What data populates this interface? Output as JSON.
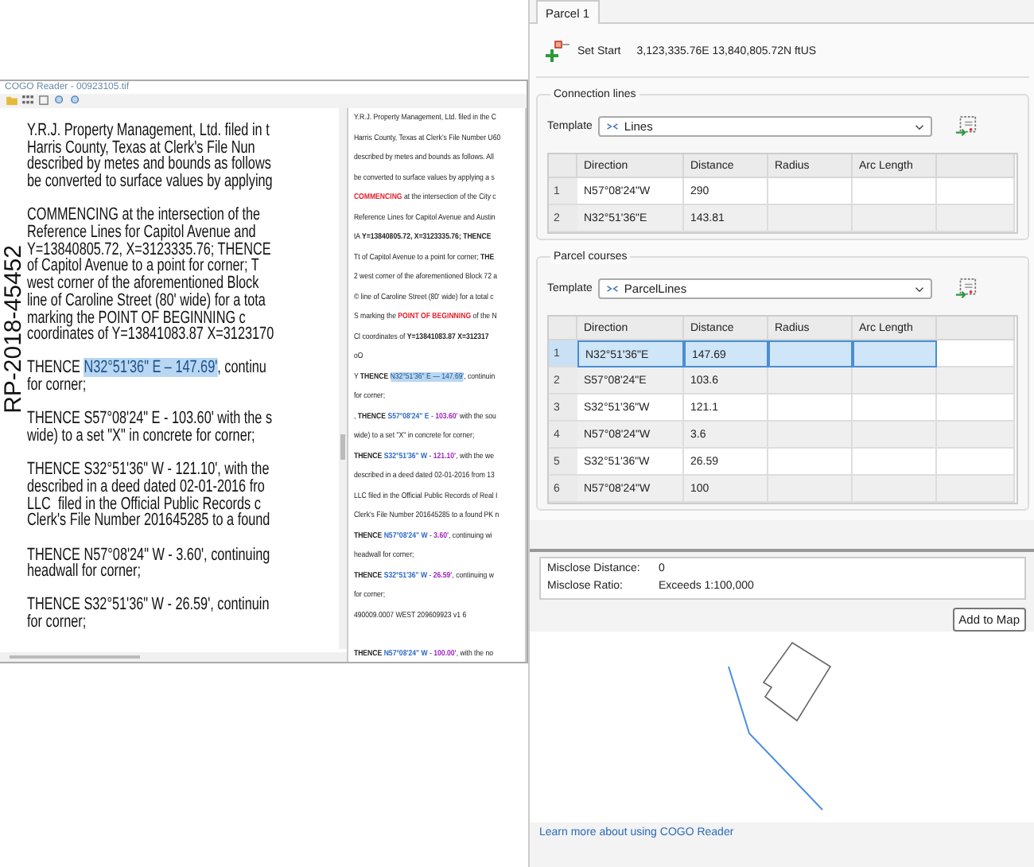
{
  "reader_window": {
    "title": "COGO Reader - 00923105.tif",
    "document": {
      "stamp": "RP-2018-45452",
      "paragraphs": [
        [
          "Y.R.J. Property Management, Ltd. filed in t",
          "Harris County, Texas at Clerk's File Nun",
          "described by metes and bounds as follows",
          "be converted to surface values by applying"
        ],
        [
          "COMMENCING at the intersection of the",
          "Reference Lines for Capitol Avenue and",
          "Y=13840805.72, X=3123335.76; THENCE",
          "of Capitol Avenue to a point for corner; T",
          "west corner of the aforementioned Block",
          "line of Caroline Street (80' wide) for a tota",
          "marking the POINT OF BEGINNING c",
          "coordinates of Y=13841083.87 X=3123170"
        ],
        [
          [
            {
              "kind": "plain",
              "text": "THENCE "
            },
            {
              "kind": "highlight",
              "text": "N32°51'36\" E – 147.69'"
            },
            {
              "kind": "plain",
              "text": ", continu"
            }
          ],
          "for corner;"
        ],
        [
          "THENCE S57°08'24\" E - 103.60' with the s",
          "wide) to a set \"X\" in concrete for corner;"
        ],
        [
          "THENCE S32°51'36\" W - 121.10', with the",
          "described in a deed dated 02-01-2016 fro",
          "LLC  filed in the Official Public Records c",
          "Clerk's File Number 201645285 to a found"
        ],
        [
          "THENCE N57°08'24\" W - 3.60', continuing",
          "headwall for corner;"
        ],
        [
          "THENCE S32°51'36\" W - 26.59', continuin",
          "for corner;"
        ]
      ]
    },
    "ocr_text": {
      "lines": [
        "Y.R.J. Property Management, Ltd. filed in the C",
        "Harris County, Texas at Clerk's File Number U60",
        "described by metes and bounds as follows. All",
        "be converted to surface values by applying a s",
        [
          {
            "kind": "red",
            "text": "COMMENCING"
          },
          {
            "kind": "plain",
            "text": " at the intersection of the City c"
          }
        ],
        "Reference Lines for Capitol Avenue and Austin",
        [
          {
            "kind": "plain",
            "text": "tA "
          },
          {
            "kind": "bold",
            "text": "Y=13840805.72, X=3123335.76; THENCE"
          }
        ],
        [
          {
            "kind": "plain",
            "text": "Tt of Capitol Avenue to a point for corner; "
          },
          {
            "kind": "bold",
            "text": "THE"
          }
        ],
        "2 west corner of the aforementioned Block 72 a",
        "© line of Caroline Street (80' wide) for a total c",
        [
          {
            "kind": "plain",
            "text": "S marking the "
          },
          {
            "kind": "red",
            "text": "POINT OF BEGINNING"
          },
          {
            "kind": "plain",
            "text": " of the N"
          }
        ],
        [
          {
            "kind": "plain",
            "text": "Cl coordinates of "
          },
          {
            "kind": "bold",
            "text": "Y=13841083.87 X=312317"
          }
        ],
        "oO",
        [
          {
            "kind": "plain",
            "text": "Y "
          },
          {
            "kind": "bold",
            "text": "THENCE "
          },
          {
            "kind": "highlight",
            "text": "N32°51'36\" E — 147.69'"
          },
          {
            "kind": "plain",
            "text": ", continuin"
          }
        ],
        "for corner;",
        [
          {
            "kind": "plain",
            "text": ", "
          },
          {
            "kind": "bold",
            "text": "THENCE "
          },
          {
            "kind": "blue",
            "text": "S57°08'24\" E"
          },
          {
            "kind": "plain",
            "text": " - "
          },
          {
            "kind": "purple",
            "text": "103.60'"
          },
          {
            "kind": "plain",
            "text": " with the sou"
          }
        ],
        "wide) to a set \"X\" in concrete for corner;",
        [
          {
            "kind": "bold",
            "text": "THENCE "
          },
          {
            "kind": "blue",
            "text": "S32°51'36\" W"
          },
          {
            "kind": "plain",
            "text": " - "
          },
          {
            "kind": "purple",
            "text": "121.10'"
          },
          {
            "kind": "plain",
            "text": ", with the we"
          }
        ],
        "described in a deed dated 02-01-2016 from 13",
        "LLC filed in the Official Public Records of Real I",
        "Clerk's File Number 201645285 to a found PK n",
        [
          {
            "kind": "bold",
            "text": "THENCE "
          },
          {
            "kind": "blue",
            "text": "N57°08'24\" W"
          },
          {
            "kind": "plain",
            "text": " - "
          },
          {
            "kind": "purple",
            "text": "3.60'"
          },
          {
            "kind": "plain",
            "text": ", continuing wi"
          }
        ],
        "headwall for corner;",
        [
          {
            "kind": "bold",
            "text": "THENCE "
          },
          {
            "kind": "blue",
            "text": "S32°51'36\" W"
          },
          {
            "kind": "plain",
            "text": " - "
          },
          {
            "kind": "purple",
            "text": "26.59'"
          },
          {
            "kind": "plain",
            "text": ", continuing w"
          }
        ],
        "for corner;",
        "490009.0007 WEST 209609923 v1 6",
        [
          {
            "kind": "bold",
            "text": "THENCE "
          },
          {
            "kind": "blue",
            "text": "N57°08'24\" W"
          },
          {
            "kind": "plain",
            "text": " - "
          },
          {
            "kind": "purple",
            "text": "100.00'"
          },
          {
            "kind": "plain",
            "text": ", with the no"
          }
        ]
      ]
    }
  },
  "parcel_panel": {
    "tabs": [
      {
        "label": "Parcel 1",
        "selected": true
      }
    ],
    "set_start": {
      "label": "Set Start",
      "coordinates": "3,123,335.76E 13,840,805.72N ftUS"
    },
    "groups": [
      {
        "title": "Connection lines",
        "template_label": "Template",
        "template_value": "Lines",
        "columns": [
          "Direction",
          "Distance",
          "Radius",
          "Arc Length"
        ],
        "rows": [
          {
            "number": "1",
            "cells": [
              "N57°08'24\"W",
              "290"
            ],
            "selected": false
          },
          {
            "number": "2",
            "cells": [
              "N32°51'36\"E",
              "143.81"
            ],
            "selected": false
          }
        ]
      },
      {
        "title": "Parcel courses",
        "template_label": "Template",
        "template_value": "ParcelLines",
        "columns": [
          "Direction",
          "Distance",
          "Radius",
          "Arc Length"
        ],
        "rows": [
          {
            "number": "1",
            "cells": [
              "N32°51'36\"E",
              "147.69"
            ],
            "selected": true
          },
          {
            "number": "2",
            "cells": [
              "S57°08'24\"E",
              "103.6"
            ],
            "selected": false
          },
          {
            "number": "3",
            "cells": [
              "S32°51'36\"W",
              "121.1"
            ],
            "selected": false
          },
          {
            "number": "4",
            "cells": [
              "N57°08'24\"W",
              "3.6"
            ],
            "selected": false
          },
          {
            "number": "5",
            "cells": [
              "S32°51'36\"W",
              "26.59"
            ],
            "selected": false
          },
          {
            "number": "6",
            "cells": [
              "N57°08'24\"W",
              "100"
            ],
            "selected": false
          }
        ]
      }
    ],
    "misclose": [
      {
        "label": "Misclose Distance:",
        "value": "0"
      },
      {
        "label": "Misclose Ratio:",
        "value": "Exceeds 1:100,000"
      }
    ],
    "add_button": "Add to Map",
    "help_link": "Learn more about using COGO Reader"
  }
}
